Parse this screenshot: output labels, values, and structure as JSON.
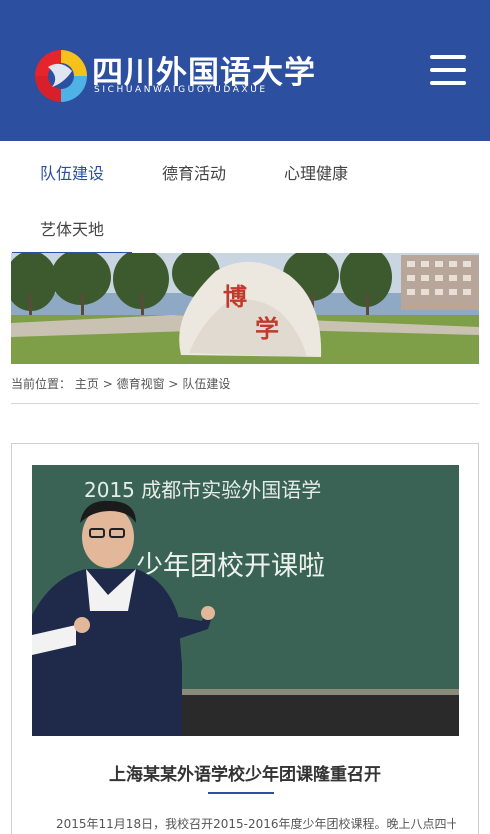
{
  "header": {
    "logo_cn": "四川外国语大学",
    "logo_en": "SICHUANWAIGUOYUDAXUE",
    "logo_icon": "university-emblem-icon",
    "menu_icon": "hamburger-menu-icon",
    "bg_color": "#2c4fa0"
  },
  "nav": {
    "items": [
      {
        "label": "队伍建设",
        "active": true
      },
      {
        "label": "德育活动",
        "active": false
      },
      {
        "label": "心理健康",
        "active": false
      },
      {
        "label": "艺体天地",
        "active": false
      }
    ],
    "active_color": "#2c4fa0"
  },
  "banner": {
    "stone_text": [
      "博",
      "学"
    ]
  },
  "breadcrumb": {
    "prefix": "当前位置：",
    "items": [
      "主页",
      "德育视窗",
      "队伍建设"
    ],
    "separator": ">"
  },
  "article": {
    "image_text": {
      "line1": "2015 成都市实验外国语学",
      "line2": "少年团校开课啦"
    },
    "title": "上海某某外语学校少年团课隆重召开",
    "summary": "2015年11月18日，我校召开2015-2016年度少年团校课程。晚上八点四十，"
  }
}
